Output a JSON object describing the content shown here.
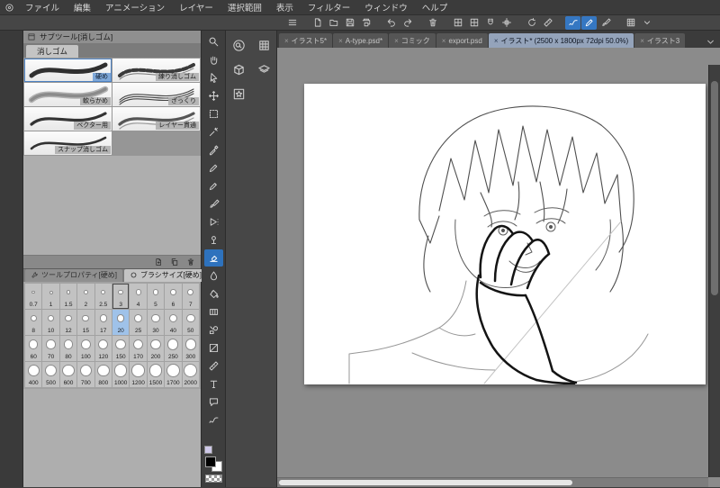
{
  "app": {
    "menus": [
      "ファイル",
      "編集",
      "アニメーション",
      "レイヤー",
      "選択範囲",
      "表示",
      "フィルター",
      "ウィンドウ",
      "ヘルプ"
    ]
  },
  "command_bar": {
    "groups": [
      {
        "items": [
          {
            "icon": "menu"
          }
        ]
      },
      {
        "items": [
          {
            "icon": "newdoc"
          },
          {
            "icon": "opendoc"
          },
          {
            "icon": "save"
          },
          {
            "icon": "print"
          }
        ]
      },
      {
        "items": [
          {
            "icon": "undo"
          },
          {
            "icon": "redo"
          }
        ]
      },
      {
        "items": [
          {
            "icon": "trash"
          }
        ]
      },
      {
        "items": [
          {
            "icon": "grid"
          },
          {
            "icon": "checker"
          },
          {
            "icon": "magnet"
          },
          {
            "icon": "crosshair"
          }
        ]
      },
      {
        "items": [
          {
            "icon": "rotate"
          },
          {
            "icon": "ruler2"
          }
        ]
      },
      {
        "items": [
          {
            "icon": "zigzag",
            "active": true
          },
          {
            "icon": "pen",
            "active": true
          },
          {
            "icon": "brush"
          }
        ]
      },
      {
        "items": [
          {
            "icon": "gridpanel"
          },
          {
            "icon": "chevdown"
          }
        ]
      }
    ]
  },
  "subtool_panel": {
    "title": "サブツール[消しゴム]",
    "tab": "消しゴム",
    "items": [
      {
        "label": "硬め",
        "selected": true,
        "style": "hard"
      },
      {
        "label": "練り消しゴム",
        "style": "kneaded"
      },
      {
        "label": "軟らかめ",
        "style": "soft"
      },
      {
        "label": "ざっくり",
        "style": "rough"
      },
      {
        "label": "ベクター用",
        "style": "vector"
      },
      {
        "label": "レイヤー貫通",
        "style": "through"
      },
      {
        "label": "スナップ消しゴム",
        "style": "snap"
      }
    ]
  },
  "property_panels": {
    "tool_property_tab": "ツールプロパティ[硬め]",
    "brush_size_tab": "ブラシサイズ[硬め]"
  },
  "brush_sizes": {
    "values": [
      0.7,
      1,
      1.5,
      2,
      2.5,
      3,
      4,
      5,
      6,
      7,
      8,
      10,
      12,
      15,
      17,
      20,
      25,
      30,
      40,
      50,
      60,
      70,
      80,
      100,
      120,
      150,
      170,
      200,
      250,
      300,
      400,
      500,
      600,
      700,
      800,
      1000,
      1200,
      1500,
      1700,
      2000
    ],
    "selected": 20,
    "outlined": 3
  },
  "tool_palette": {
    "tools": [
      {
        "icon": "zoomtool"
      },
      {
        "icon": "handtool"
      },
      {
        "icon": "cursorop"
      },
      {
        "icon": "movecross"
      },
      {
        "icon": "selectrect"
      },
      {
        "icon": "wand"
      },
      {
        "icon": "eyedrop"
      },
      {
        "icon": "pen"
      },
      {
        "icon": "pencil"
      },
      {
        "icon": "brush"
      },
      {
        "icon": "airbrush"
      },
      {
        "icon": "deco"
      },
      {
        "icon": "eraser"
      },
      {
        "icon": "blend"
      },
      {
        "icon": "fill"
      },
      {
        "icon": "gradient"
      },
      {
        "icon": "figure"
      },
      {
        "icon": "frame"
      },
      {
        "icon": "rulertool"
      },
      {
        "icon": "text"
      },
      {
        "icon": "balloon"
      },
      {
        "icon": "zigzag"
      }
    ],
    "selected": "eraser",
    "main_color": "#000000",
    "sub_color": "#cfc9e9"
  },
  "dock": {
    "items": [
      {
        "icon": "navzoom"
      },
      {
        "icon": "gridpanel"
      },
      {
        "icon": "cube"
      },
      {
        "icon": "layersic"
      },
      {
        "icon": "starbox"
      }
    ]
  },
  "documents": {
    "tabs": [
      {
        "label": "イラスト5*"
      },
      {
        "label": "A-type.psd*"
      },
      {
        "label": "コミック"
      },
      {
        "label": "export.psd"
      },
      {
        "label": "イラスト* (2500 x 1800px 72dpi 50.0%)",
        "active": true
      },
      {
        "label": "イラスト3"
      }
    ]
  }
}
